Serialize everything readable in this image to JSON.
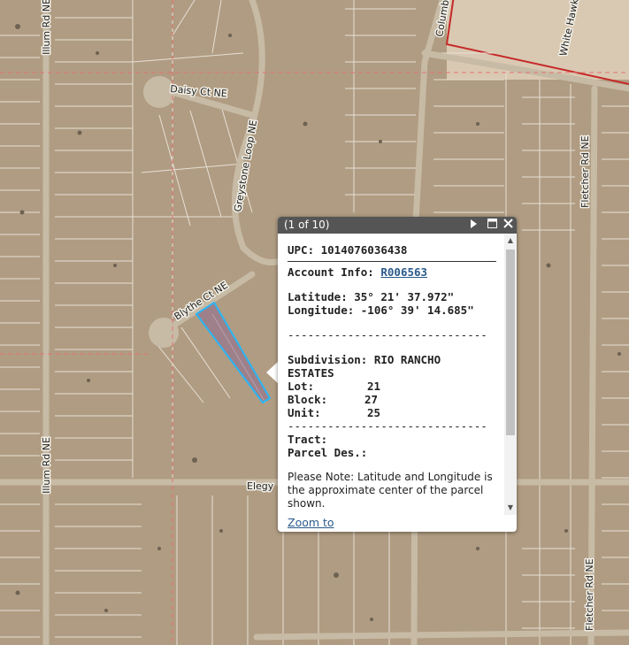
{
  "map": {
    "roads": {
      "illum_top": "Illum Rd NE",
      "illum_bottom": "Illum Rd NE",
      "daisy": "Daisy Ct NE",
      "greystone": "Greystone Loop NE",
      "blythe": "Blythe Ct NE",
      "elegy": "Elegy",
      "columbia": "Columbi",
      "white_hawk": "White Hawk",
      "fletcher_top": "Fletcher Rd NE",
      "fletcher_bottom": "Fletcher Rd NE"
    },
    "colors": {
      "ground": "#b09c82",
      "parcel_line": "#e6e0d6",
      "road": "#c7bba6",
      "highlight": "#29b6f6",
      "boundary_red": "#e53935"
    }
  },
  "popup": {
    "header": {
      "count": "(1 of 10)"
    },
    "upc": "UPC: 1014076036438",
    "account_label": "Account Info:",
    "account_value": "R006563",
    "latitude": "Latitude: 35° 21' 37.972\"",
    "longitude": "Longitude: -106° 39' 14.685\"",
    "dashes1": "------------------------------",
    "subdivision_line1": "Subdivision: RIO RANCHO",
    "subdivision_line2": "ESTATES",
    "lot_label": "Lot:",
    "lot_value": "21",
    "block_label": "Block:",
    "block_value": "27",
    "unit_label": "Unit:",
    "unit_value": "25",
    "dashes2": "------------------------------",
    "tract": "Tract:",
    "parcel_des": "Parcel Des.:",
    "note": "Please Note: Latitude and Longitude is the approximate center of the parcel shown.",
    "zoom_to": "Zoom to"
  }
}
